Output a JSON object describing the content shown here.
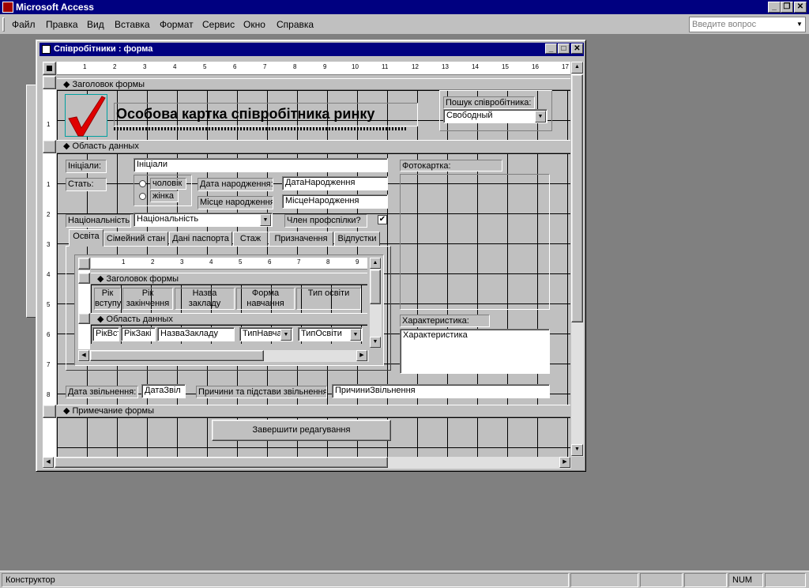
{
  "app": {
    "title": "Microsoft Access"
  },
  "menubar": {
    "items": [
      "Файл",
      "Правка",
      "Вид",
      "Вставка",
      "Формат",
      "Сервис",
      "Окно",
      "Справка"
    ],
    "ask_placeholder": "Введите вопрос"
  },
  "form_window": {
    "title": "Співробітники : форма"
  },
  "ruler": {
    "marks": [
      "1",
      "2",
      "3",
      "4",
      "5",
      "6",
      "7",
      "8",
      "9",
      "10",
      "11",
      "12",
      "13",
      "14",
      "15",
      "16",
      "17"
    ],
    "vmarks": [
      "1",
      "1",
      "2",
      "3",
      "4",
      "5",
      "6",
      "7",
      "8"
    ]
  },
  "header_section": {
    "label": "Заголовок формы",
    "title": "Особова картка співробітника ринку",
    "search_label": "Пошук співробітника:",
    "search_value": "Свободный"
  },
  "detail_section": {
    "label": "Область данных",
    "initials_label": "Ініціали:",
    "initials_value": "Ініціали",
    "gender_label": "Стать:",
    "gender_options": [
      "чоловік",
      "жінка"
    ],
    "birth_date_label": "Дата народження:",
    "birth_date_value": "ДатаНародження",
    "birth_place_label": "Місце народження:",
    "birth_place_value": "МісцеНародження",
    "nationality_label": "Національність",
    "nationality_value": "Національність",
    "union_label": "Член профспілки?",
    "union_checked": true,
    "photo_label": "Фотокартка:",
    "characteristic_label": "Характеристика:",
    "characteristic_value": "Характеристика",
    "dismissal_date_label": "Дата звільнення:",
    "dismissal_date_value": "ДатаЗвіл",
    "dismissal_reason_label": "Причини та підстави звільнення:",
    "dismissal_reason_value": "ПричиниЗвільнення"
  },
  "tabs": [
    "Освіта",
    "Сімейний стан",
    "Дані паспорта",
    "Стаж",
    "Призначення",
    "Відпустки"
  ],
  "subform": {
    "ruler_marks": [
      "1",
      "2",
      "3",
      "4",
      "5",
      "6",
      "7",
      "8",
      "9"
    ],
    "header_label": "Заголовок формы",
    "detail_label": "Область данных",
    "columns": [
      "Рік вступу",
      "Рік закінчення",
      "Назва закладу",
      "Форма навчання",
      "Тип освіти"
    ],
    "fields": [
      "РікВст",
      "РікЗакі",
      "НазваЗакладу",
      "ТипНавча",
      "ТипОсвіти"
    ]
  },
  "footer_section": {
    "label": "Примечание формы",
    "button": "Завершити редагування"
  },
  "statusbar": {
    "mode": "Конструктор",
    "num": "NUM"
  }
}
